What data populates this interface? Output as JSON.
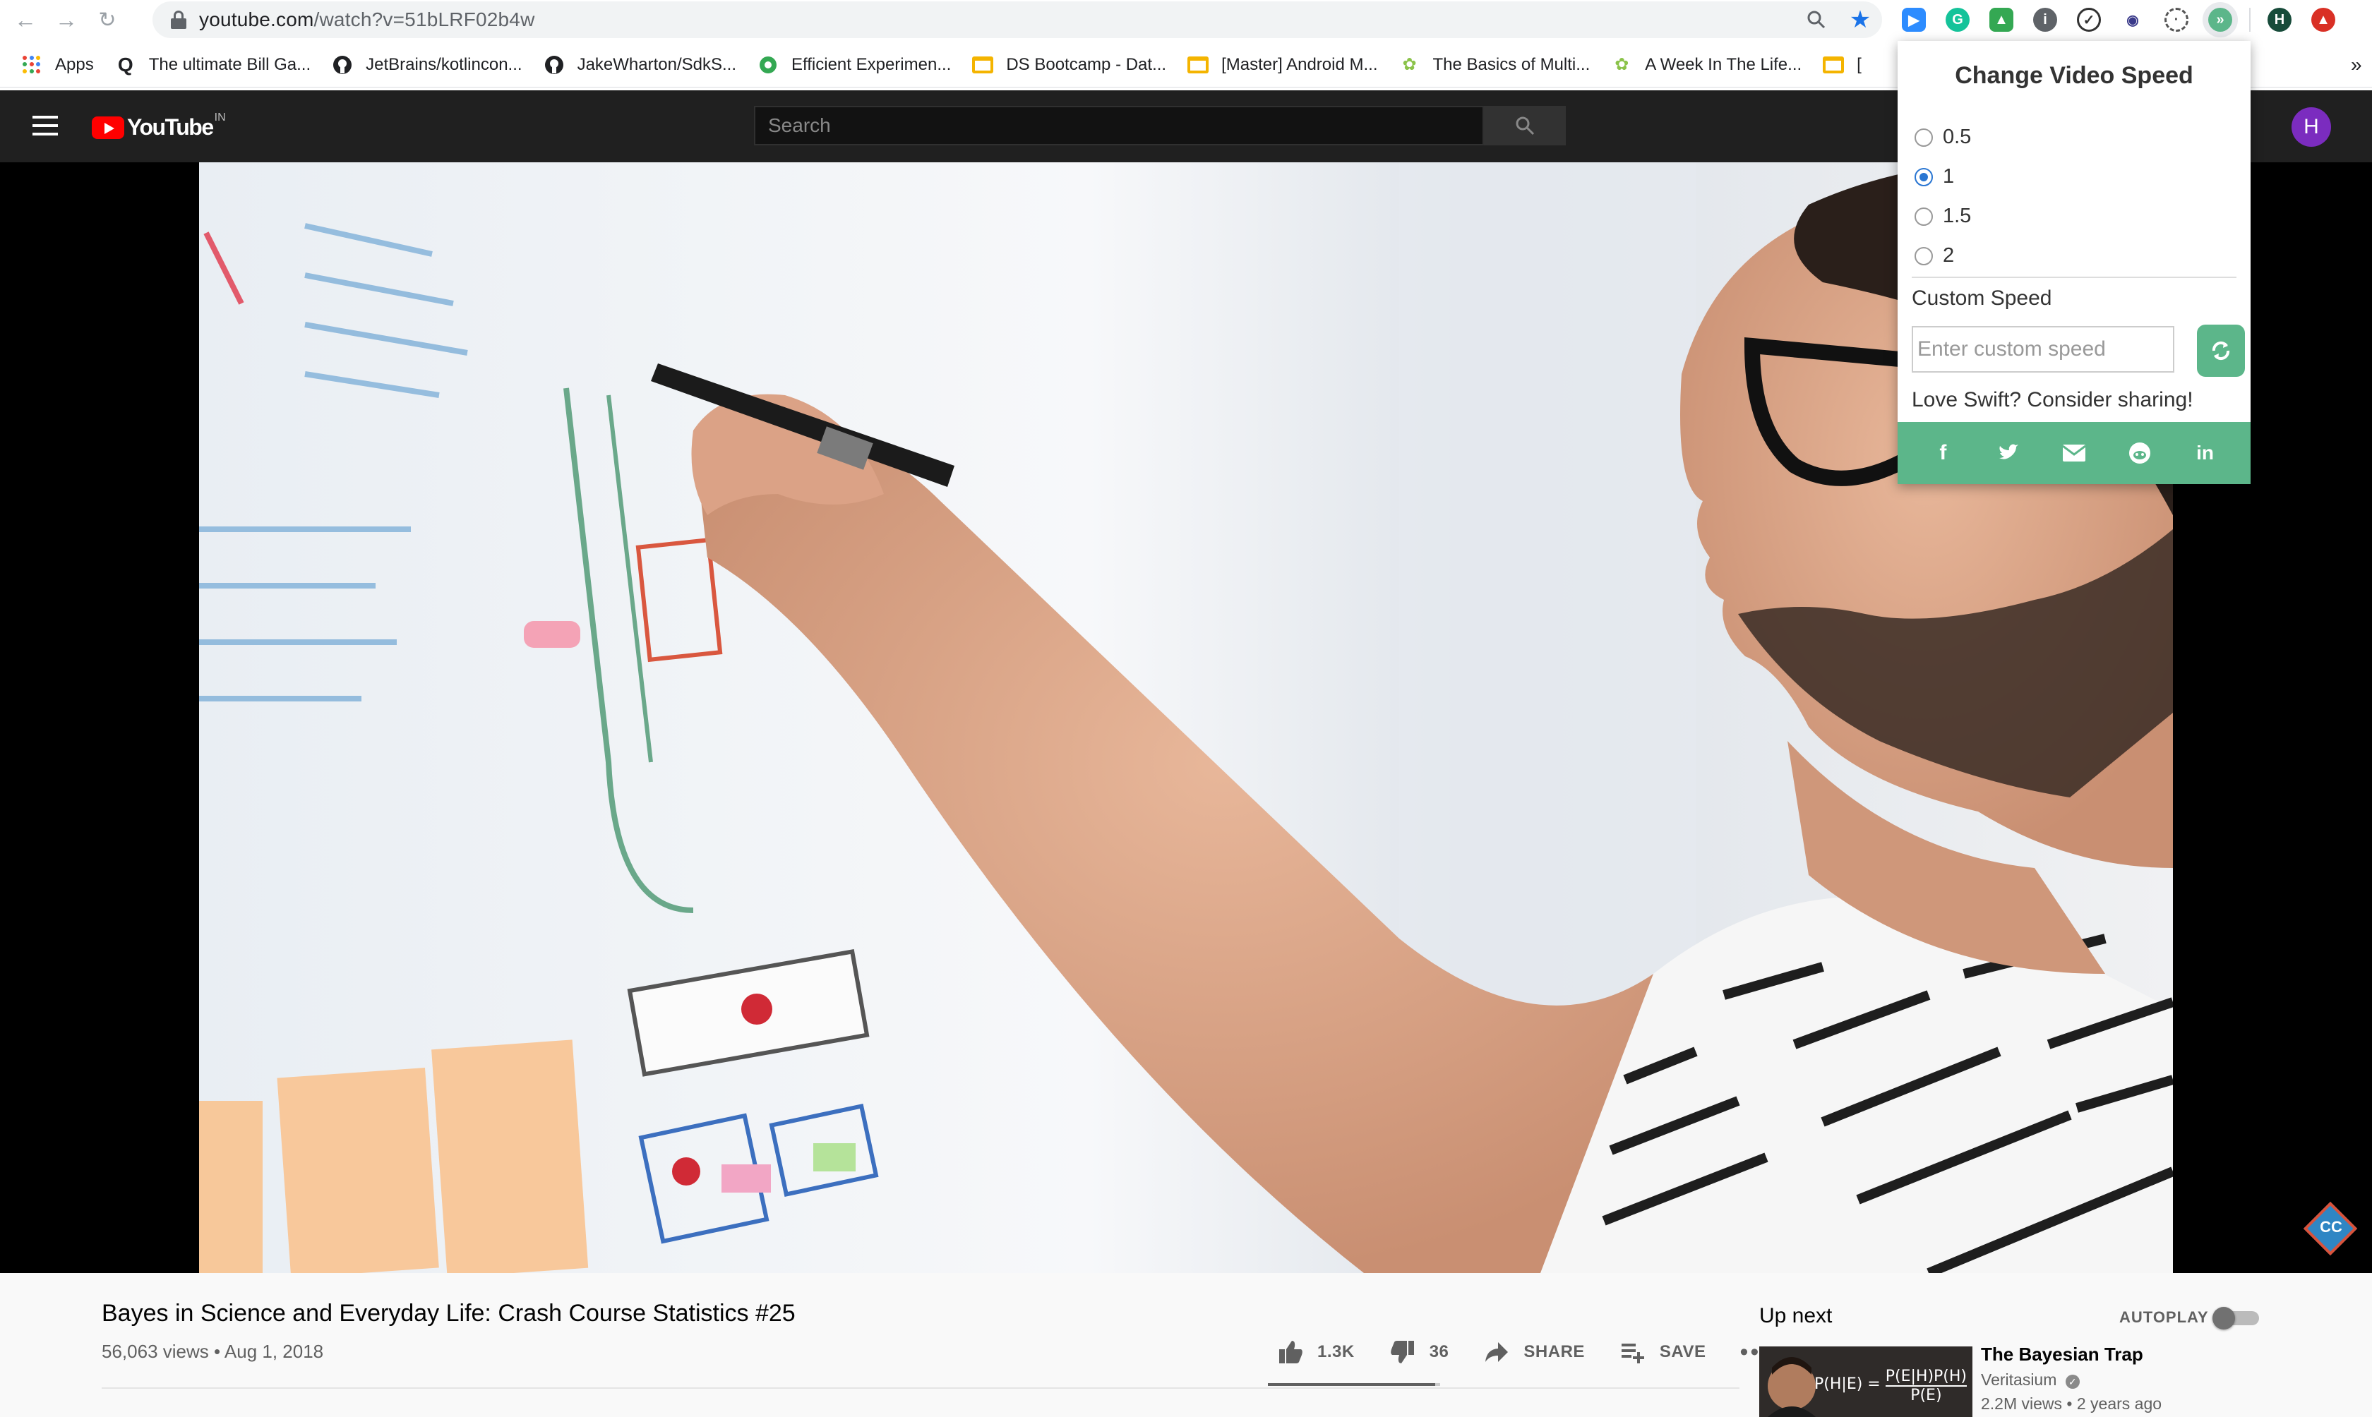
{
  "browser": {
    "url_host": "youtube.com",
    "url_path": "/watch?v=51bLRF02b4w",
    "profile_initial": "H"
  },
  "bookmarks": [
    {
      "label": "Apps",
      "icon": "apps-grid-icon"
    },
    {
      "label": "The ultimate Bill Ga...",
      "icon": "quora-icon"
    },
    {
      "label": "JetBrains/kotlincon...",
      "icon": "github-icon"
    },
    {
      "label": "JakeWharton/SdkS...",
      "icon": "github-icon"
    },
    {
      "label": "Efficient Experimen...",
      "icon": "green-circle-icon"
    },
    {
      "label": "DS Bootcamp - Dat...",
      "icon": "slides-icon"
    },
    {
      "label": "[Master] Android M...",
      "icon": "slides-icon"
    },
    {
      "label": "The Basics of Multi...",
      "icon": "leaf-icon"
    },
    {
      "label": "A Week In The Life...",
      "icon": "leaf-icon"
    },
    {
      "label": "[",
      "icon": "slides-icon"
    }
  ],
  "bookmarks_overflow": "»",
  "youtube": {
    "logo_text": "YouTube",
    "country": "IN",
    "search_placeholder": "Search",
    "avatar_initial": "H"
  },
  "video": {
    "title": "Bayes in Science and Everyday Life: Crash Course Statistics #25",
    "views": "56,063 views",
    "separator": " • ",
    "date": "Aug 1, 2018",
    "likes": "1.3K",
    "dislikes": "36",
    "like_ratio": 0.97,
    "share_label": "SHARE",
    "save_label": "SAVE",
    "more_label": "•••",
    "cc_label": "CC"
  },
  "sidebar": {
    "up_next_label": "Up next",
    "autoplay_label": "AUTOPLAY",
    "autoplay_on": false,
    "next_video": {
      "title": "The Bayesian Trap",
      "channel": "Veritasium",
      "stats": "2.2M views • 2 years ago",
      "thumb_lhs": "P(H|E) =",
      "thumb_num": "P(E|H)P(H)",
      "thumb_den": "P(E)"
    }
  },
  "popup": {
    "title": "Change Video Speed",
    "options": [
      "0.5",
      "1",
      "1.5",
      "2"
    ],
    "selected": "1",
    "custom_label": "Custom Speed",
    "custom_placeholder": "Enter custom speed",
    "share_text": "Love Swift? Consider sharing!",
    "share_icons": [
      "facebook-icon",
      "twitter-icon",
      "email-icon",
      "reddit-icon",
      "linkedin-icon"
    ]
  },
  "colors": {
    "accent_green": "#5cb68a",
    "radio_blue": "#2a76d2",
    "youtube_red": "#ff0000",
    "header_dark": "#202020"
  }
}
